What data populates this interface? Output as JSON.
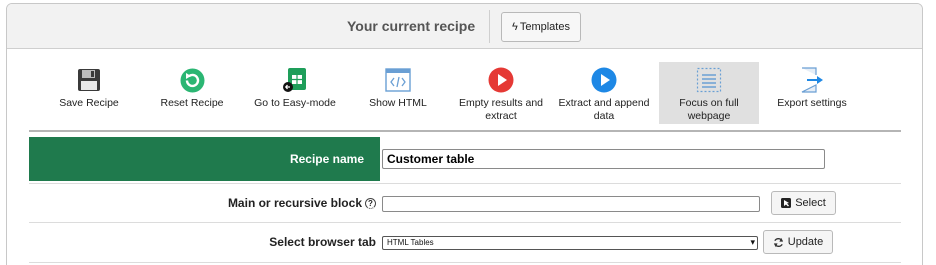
{
  "header": {
    "title": "Your current recipe",
    "templates_label": "Templates"
  },
  "toolbar": {
    "items": [
      {
        "label": "Save Recipe",
        "icon": "floppy-disk-icon"
      },
      {
        "label": "Reset Recipe",
        "icon": "reset-icon"
      },
      {
        "label": "Go to Easy-mode",
        "icon": "spreadsheet-icon"
      },
      {
        "label": "Show HTML",
        "icon": "code-window-icon"
      },
      {
        "label": "Empty results and extract",
        "icon": "play-red-icon"
      },
      {
        "label": "Extract and append data",
        "icon": "play-blue-icon"
      },
      {
        "label": "Focus on full webpage",
        "icon": "full-page-icon",
        "active": true
      },
      {
        "label": "Export settings",
        "icon": "export-icon"
      }
    ]
  },
  "form": {
    "recipe_name_label": "Recipe name",
    "recipe_name_value": "Customer table",
    "block_label": "Main or recursive block",
    "block_help": "?",
    "block_value": "",
    "select_label": "Select",
    "tab_label": "Select browser tab",
    "tab_value": "HTML Tables",
    "update_label": "Update"
  },
  "colors": {
    "accent_green": "#1f7a4d",
    "play_red": "#e53935",
    "play_blue": "#1e88e5",
    "reset_green": "#2bb673"
  }
}
